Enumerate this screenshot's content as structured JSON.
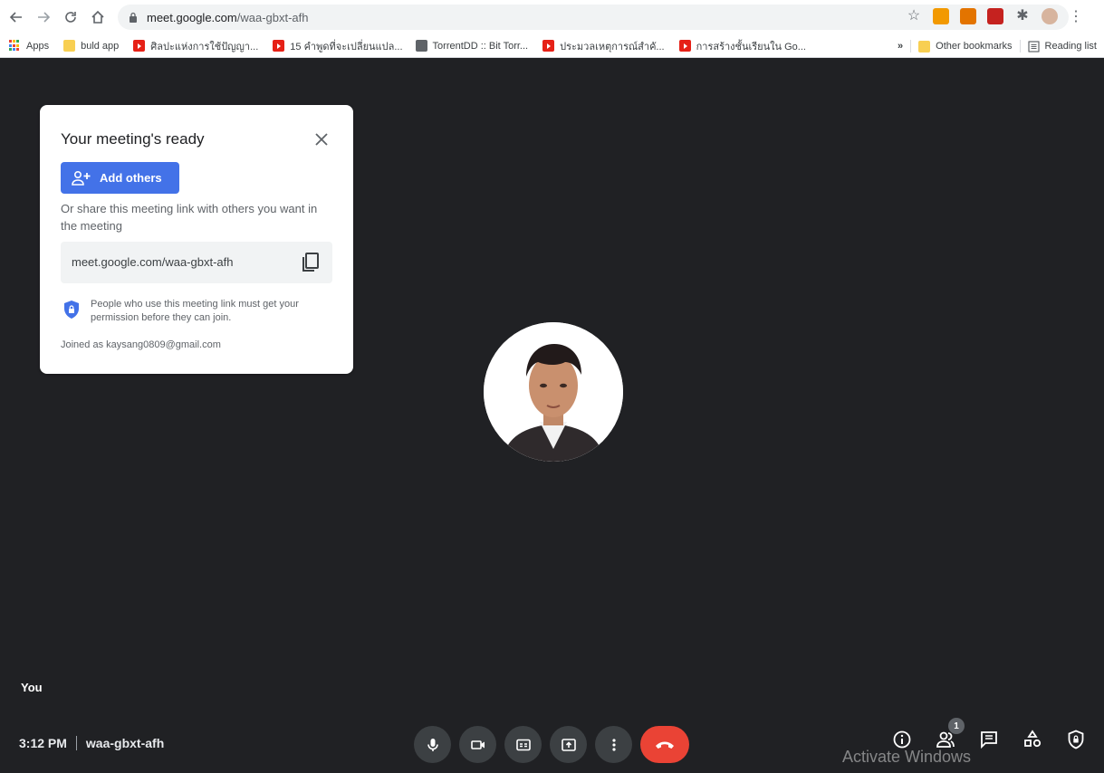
{
  "browser": {
    "url_host": "meet.google.com",
    "url_path": "/waa-gbxt-afh",
    "bookmarks": [
      {
        "label": "Apps",
        "icon": "apps-grid-icon"
      },
      {
        "label": "buld app",
        "icon": "folder-icon"
      },
      {
        "label": "ศิลปะแห่งการใช้ปัญญา...",
        "icon": "youtube-icon"
      },
      {
        "label": "15 คำพูดที่จะเปลี่ยนแปล...",
        "icon": "youtube-icon"
      },
      {
        "label": "TorrentDD :: Bit Torr...",
        "icon": "globe-icon"
      },
      {
        "label": "ประมวลเหตุการณ์สำคั...",
        "icon": "youtube-icon"
      },
      {
        "label": "การสร้างชั้นเรียนใน Go...",
        "icon": "youtube-icon"
      }
    ],
    "overflow": "»",
    "other_bookmarks": "Other bookmarks",
    "reading_list": "Reading list"
  },
  "card": {
    "title": "Your meeting's ready",
    "add_others": "Add others",
    "share_text": "Or share this meeting link with others you want in the meeting",
    "link": "meet.google.com/waa-gbxt-afh",
    "permission_text": "People who use this meeting link must get your permission before they can join.",
    "joined_as": "Joined as kaysang0809@gmail.com"
  },
  "stage": {
    "self_label": "You",
    "time": "3:12 PM",
    "meeting_code": "waa-gbxt-afh",
    "participants_count": "1",
    "watermark": "Activate Windows"
  },
  "colors": {
    "stage_bg": "#202124",
    "accent": "#4372e8",
    "end_call": "#ea4335"
  }
}
